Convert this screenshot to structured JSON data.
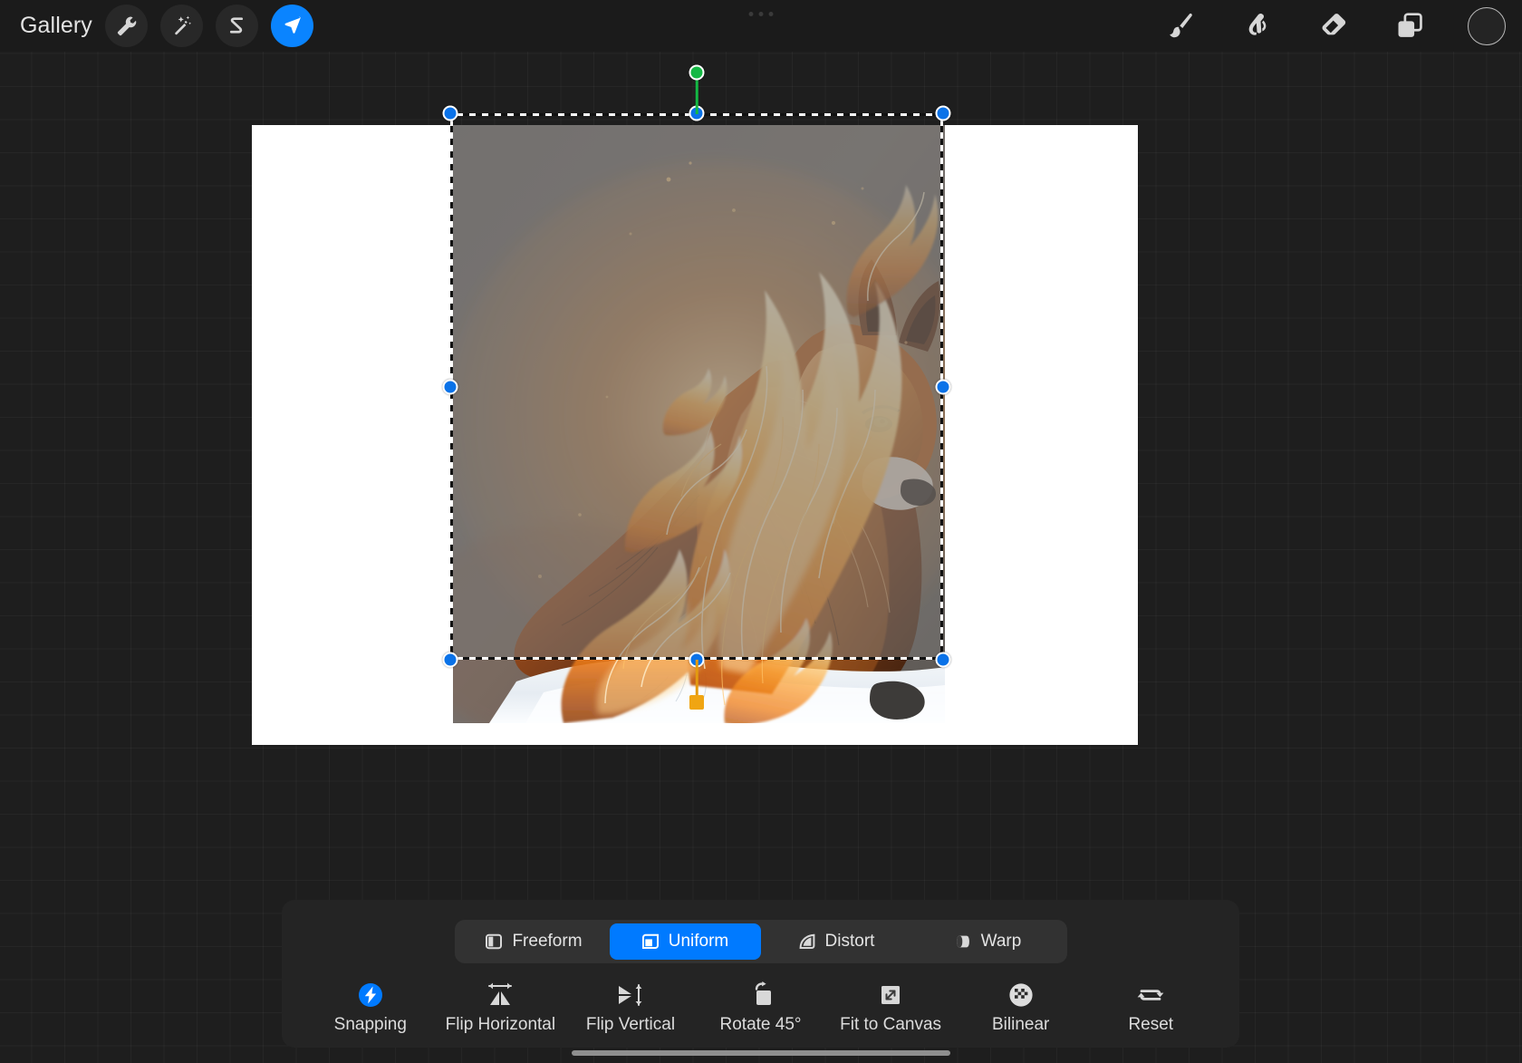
{
  "app": {
    "name": "Procreate",
    "accent_color": "#007AFF",
    "handle_color": "#0A72E8",
    "rotate_handle_color": "#14B844",
    "distort_handle_color": "#F0A512",
    "canvas_bg_color": "#1E1E1E",
    "panel_bg_color": "#242424"
  },
  "topbar": {
    "gallery_label": "Gallery",
    "left_tools": [
      {
        "name": "wrench-icon",
        "label": "Actions",
        "active": false
      },
      {
        "name": "magic-wand-icon",
        "label": "Adjustments",
        "active": false
      },
      {
        "name": "s-curve-icon",
        "label": "Selection",
        "active": false
      },
      {
        "name": "arrow-cursor-icon",
        "label": "Transform",
        "active": true
      }
    ],
    "right_tools": [
      {
        "name": "paintbrush-icon",
        "label": "Paint"
      },
      {
        "name": "smudge-icon",
        "label": "Smudge"
      },
      {
        "name": "eraser-icon",
        "label": "Erase"
      },
      {
        "name": "layers-icon",
        "label": "Layers"
      }
    ],
    "color_swatch": {
      "name": "color-swatch",
      "label": "Color",
      "value": "#242424"
    }
  },
  "transform_panel": {
    "modes": [
      {
        "label": "Freeform",
        "icon": "freeform-icon",
        "active": false
      },
      {
        "label": "Uniform",
        "icon": "uniform-icon",
        "active": true
      },
      {
        "label": "Distort",
        "icon": "distort-icon",
        "active": false
      },
      {
        "label": "Warp",
        "icon": "warp-icon",
        "active": false
      }
    ],
    "actions": [
      {
        "label": "Snapping",
        "icon": "snapping-bolt-icon",
        "active": true
      },
      {
        "label": "Flip Horizontal",
        "icon": "flip-horizontal-icon",
        "active": false
      },
      {
        "label": "Flip Vertical",
        "icon": "flip-vertical-icon",
        "active": false
      },
      {
        "label": "Rotate 45°",
        "icon": "rotate-45-icon",
        "active": false
      },
      {
        "label": "Fit to Canvas",
        "icon": "fit-to-canvas-icon",
        "active": false
      },
      {
        "label": "Bilinear",
        "icon": "bilinear-icon",
        "active": false
      },
      {
        "label": "Reset",
        "icon": "reset-icon",
        "active": false
      }
    ]
  },
  "artwork": {
    "title": "Fox on fire",
    "subject": "red fox in snow engulfed in flames",
    "canvas_background": "#FFFFFF",
    "selection_tint": "rgba(120,118,116,0.55)"
  },
  "selection": {
    "mode": "Uniform",
    "handles": [
      {
        "name": "handle-top-left",
        "kind": "corner"
      },
      {
        "name": "handle-top-center",
        "kind": "edge"
      },
      {
        "name": "handle-top-right",
        "kind": "corner"
      },
      {
        "name": "handle-middle-left",
        "kind": "edge"
      },
      {
        "name": "handle-middle-right",
        "kind": "edge"
      },
      {
        "name": "handle-bottom-left",
        "kind": "corner"
      },
      {
        "name": "handle-bottom-center",
        "kind": "edge"
      },
      {
        "name": "handle-bottom-right",
        "kind": "corner"
      },
      {
        "name": "handle-rotate",
        "kind": "rotate"
      },
      {
        "name": "handle-distort",
        "kind": "distort"
      }
    ]
  }
}
